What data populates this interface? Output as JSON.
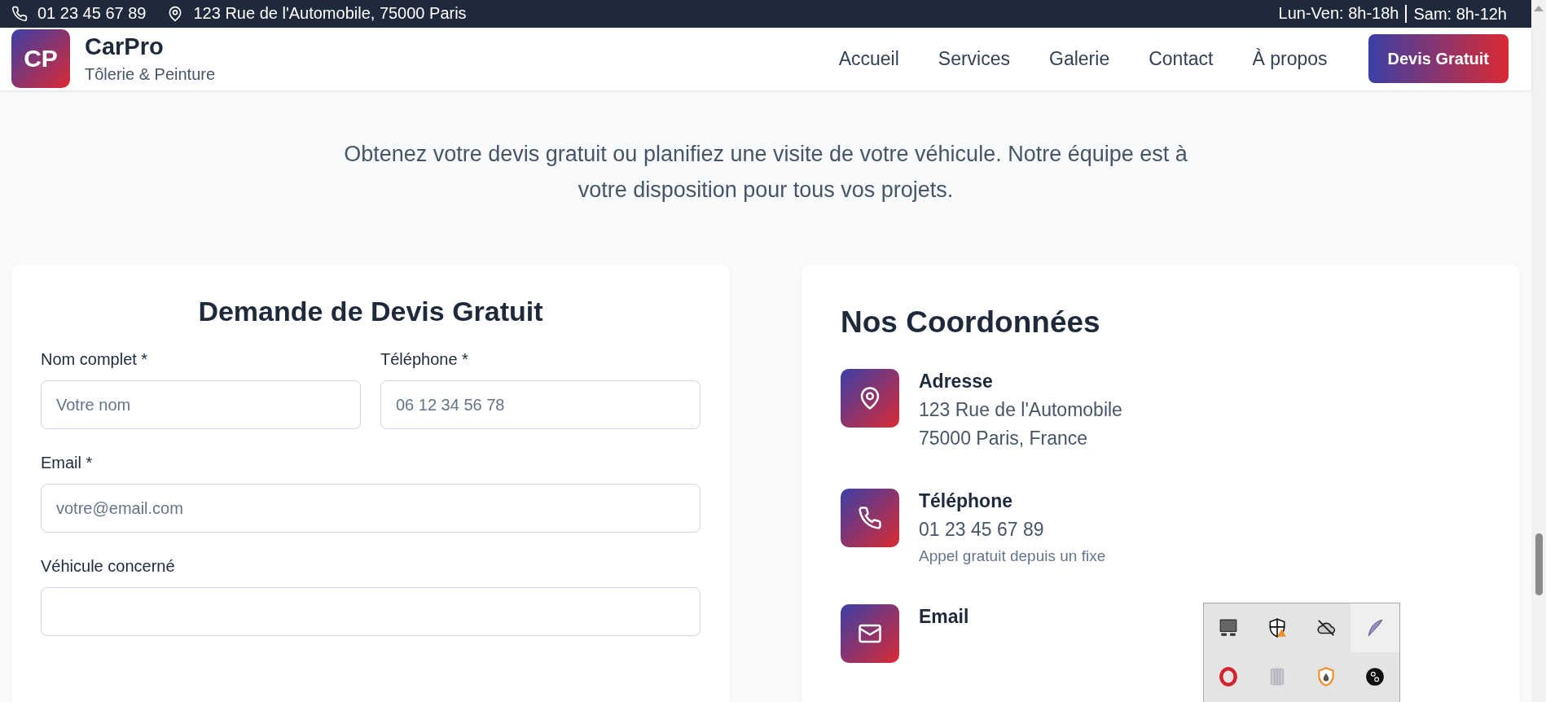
{
  "top_bar": {
    "phone": "01 23 45 67 89",
    "address": "123 Rue de l'Automobile, 75000 Paris",
    "hours": [
      "Lun-Ven: 8h-18h",
      "Sam: 8h-12h"
    ]
  },
  "header": {
    "logo": {
      "initials": "CP",
      "name": "CarPro",
      "tagline": "Tôlerie & Peinture"
    },
    "nav": [
      "Accueil",
      "Services",
      "Galerie",
      "Contact",
      "À propos"
    ],
    "cta": "Devis Gratuit"
  },
  "intro": "Obtenez votre devis gratuit ou planifiez une visite de votre véhicule. Notre équipe est à votre disposition pour tous vos projets.",
  "quote_form": {
    "title": "Demande de Devis Gratuit",
    "rows": [
      [
        {
          "label": "Nom complet *",
          "placeholder": "Votre nom"
        },
        {
          "label": "Téléphone *",
          "placeholder": "06 12 34 56 78"
        }
      ],
      [
        {
          "label": "Email *",
          "placeholder": "votre@email.com"
        }
      ],
      [
        {
          "label": "Véhicule concerné"
        }
      ]
    ]
  },
  "contact_info": {
    "title": "Nos Coordonnées",
    "items": [
      {
        "kind": "address",
        "title": "Adresse",
        "lines": [
          "123 Rue de l'Automobile",
          "75000 Paris, France"
        ]
      },
      {
        "kind": "phone",
        "title": "Téléphone",
        "lines": [
          "01 23 45 67 89"
        ],
        "note": "Appel gratuit depuis un fixe"
      },
      {
        "kind": "email",
        "title": "Email"
      }
    ]
  }
}
